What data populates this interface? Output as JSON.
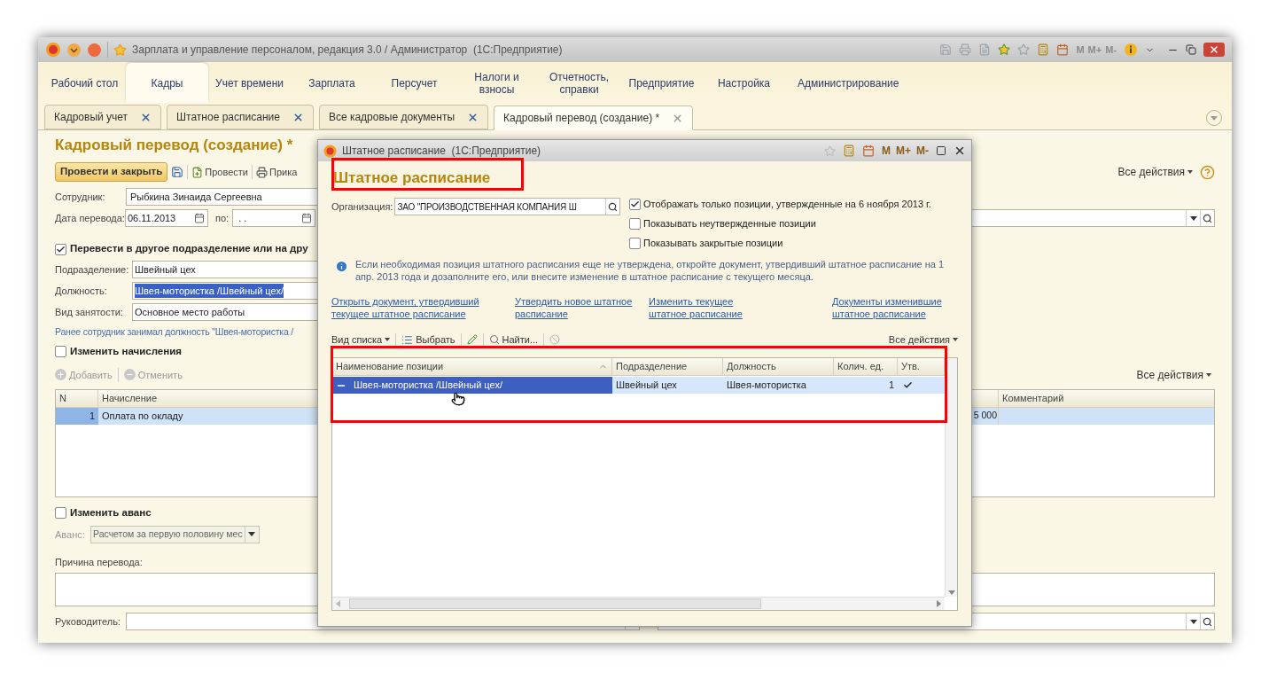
{
  "app_window": {
    "title": "Зарплата и управление персоналом, редакция 3.0 / Администратор  (1С:Предприятие)",
    "memory_buttons": [
      "M",
      "M+",
      "M-"
    ]
  },
  "sections": [
    {
      "label": "Рабочий стол",
      "selected": false
    },
    {
      "label": "Кадры",
      "selected": true
    },
    {
      "label": "Учет времени",
      "selected": false
    },
    {
      "label": "Зарплата",
      "selected": false
    },
    {
      "label": "Персучет",
      "selected": false
    },
    {
      "label": "Налоги и взносы",
      "selected": false
    },
    {
      "label": "Отчетность, справки",
      "selected": false
    },
    {
      "label": "Предприятие",
      "selected": false
    },
    {
      "label": "Настройка",
      "selected": false
    },
    {
      "label": "Администрирование",
      "selected": false
    }
  ],
  "open_tabs": [
    {
      "label": "Кадровый учет",
      "selected": false
    },
    {
      "label": "Штатное расписание",
      "selected": false
    },
    {
      "label": "Все кадровые документы",
      "selected": false
    },
    {
      "label": "Кадровый перевод (создание) *",
      "selected": true
    }
  ],
  "document": {
    "title": "Кадровый перевод (создание) *",
    "toolbar": {
      "primary": "Провести и закрыть",
      "post": "Провести",
      "print": "Прика",
      "all_actions": "Все действия"
    },
    "employee": {
      "label": "Сотрудник:",
      "value": "Рыбкина Зинаида Сергеевна"
    },
    "transfer_date": {
      "label": "Дата перевода:",
      "value": "06.11.2013",
      "to_label": "по:",
      "to_value": ". ."
    },
    "transfer_option": {
      "label": "Перевести в другое подразделение или на дру",
      "checked": true
    },
    "fields": [
      {
        "label": "Подразделение:",
        "value": "Швейный цех",
        "highlighted": false
      },
      {
        "label": "Должность:",
        "value": "Швея-мотористка /Швейный цех/",
        "highlighted": true
      },
      {
        "label": "Вид занятости:",
        "value": "Основное место работы",
        "highlighted": false
      }
    ],
    "note": "Ранее сотрудник занимал должность \"Швея-мотористка /",
    "change_accruals": {
      "label": "Изменить начисления",
      "checked": false
    },
    "accrual_toolbar": {
      "buttons": [
        {
          "label": "Добавить",
          "disabled": true
        },
        {
          "label": "Отменить",
          "disabled": true
        }
      ],
      "all_actions": "Все действия"
    },
    "accruals_table": {
      "columns": [
        "N",
        "Начисление",
        "Комментарий"
      ],
      "rows": [
        {
          "n": "1",
          "accrual": "Оплата по окладу",
          "amount": "5 000",
          "selected": true
        }
      ]
    },
    "change_advance": {
      "label": "Изменить аванс",
      "checked": false
    },
    "advance": {
      "label": "Аванс:",
      "value": "Расчетом за первую половину мес",
      "disabled": true
    },
    "reason": {
      "label": "Причина перевода:"
    },
    "manager": {
      "label": "Руководитель:"
    }
  },
  "dialog": {
    "title": "Штатное расписание  (1С:Предприятие)",
    "memory_buttons": [
      "M",
      "M+",
      "M-"
    ],
    "heading": "Штатное расписание",
    "organization": {
      "label": "Организация:",
      "value": "ЗАО \"ПРОИЗВОДСТВЕННАЯ КОМПАНИЯ Ш"
    },
    "options": [
      {
        "label": "Отображать только позиции, утвержденные на 6 ноября 2013 г.",
        "checked": true
      },
      {
        "label": "Показывать неутвержденные позиции",
        "checked": false
      },
      {
        "label": "Показывать закрытые позиции",
        "checked": false
      }
    ],
    "info": "Если необходимая позиция штатного расписания еще не утверждена, откройте документ, утвердивший штатное расписание на 1 апр. 2013 года и дозаполните его, или внесите изменение в штатное расписание с текущего месяца.",
    "links": [
      "Открыть документ, утвердивший текущее штатное расписание",
      "Утвердить новое штатное расписание",
      "Изменить текущее штатное расписание",
      "Документы изменившие штатное расписание"
    ],
    "list_toolbar": {
      "view": "Вид списка",
      "select": "Выбрать",
      "find": "Найти...",
      "all_actions": "Все действия"
    },
    "table": {
      "columns": [
        "Наименование позиции",
        "Подразделение",
        "Должность",
        "Колич. ед.",
        "Утв."
      ],
      "rows": [
        {
          "name": "Швея-мотористка /Швейный цех/",
          "department": "Швейный цех",
          "position": "Швея-мотористка",
          "units": "1",
          "approved": true,
          "selected": true
        }
      ]
    }
  }
}
